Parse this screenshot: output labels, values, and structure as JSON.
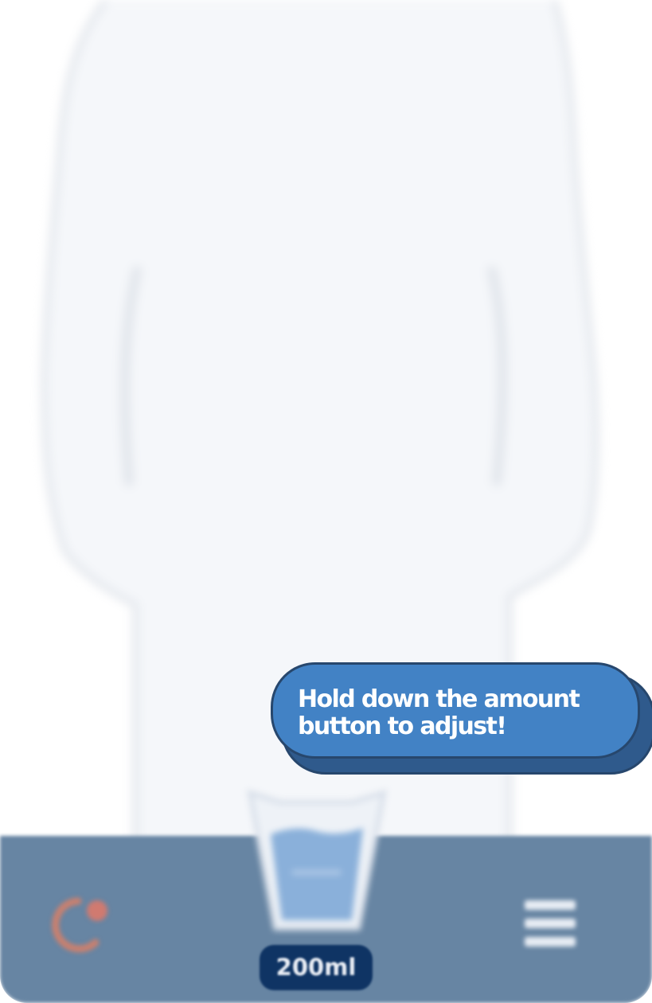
{
  "tooltip": {
    "line1": "Hold down the amount",
    "line2": "button to adjust!"
  },
  "amount": {
    "label": "200ml"
  },
  "glass": {
    "fill_fraction": 0.6
  },
  "icons": {
    "reset": "refresh-icon",
    "menu": "menu-icon",
    "glass": "water-glass-icon"
  },
  "colors": {
    "bottom_bar": "#6785a3",
    "tooltip_fill": "#4282c5",
    "tooltip_border": "#27476d",
    "amount_pill": "#0f3464",
    "body_fill": "#f5f7fa",
    "water": "#8ab0da",
    "reset_icon": "#c9806f"
  }
}
